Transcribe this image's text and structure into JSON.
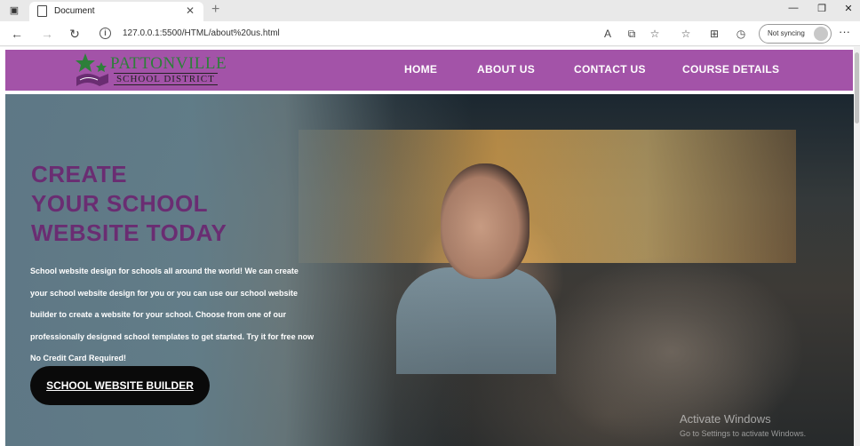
{
  "browser": {
    "tab_title": "Document",
    "tab_close": "✕",
    "new_tab": "+",
    "url": "127.0.0.1:5500/HTML/about%20us.html",
    "profile_text": "Not syncing",
    "window_controls": {
      "minimize": "—",
      "restore": "❐",
      "close": "✕"
    },
    "icons": [
      "back-icon",
      "forward-icon",
      "refresh-icon",
      "info-icon",
      "read-aloud-icon",
      "app-available-icon",
      "add-favorite-icon",
      "favorites-icon",
      "collections-icon",
      "history-icon",
      "more-icon"
    ]
  },
  "site": {
    "logo_main": "PATTONVILLE",
    "logo_sub": "SCHOOL DISTRICT",
    "brand_color": "#a353a8",
    "nav": [
      {
        "label": "HOME"
      },
      {
        "label": "ABOUT US"
      },
      {
        "label": "CONTACT US"
      },
      {
        "label": "COURSE DETAILS"
      }
    ]
  },
  "hero": {
    "title_lines": [
      "CREATE",
      "YOUR SCHOOL",
      "WEBSITE TODAY"
    ],
    "title_color": "#6a2d72",
    "text_lines": [
      "School website design for schools all around the world! We can create",
      "your school website design for you or you can use our school website",
      "builder to create a website for your school. Choose from one of our",
      "professionally designed school templates to get started. Try it for free now",
      "No Credit Card Required!"
    ],
    "cta_label": "SCHOOL WEBSITE BUILDER"
  },
  "watermark": {
    "title": "Activate Windows",
    "subtitle": "Go to Settings to activate Windows."
  }
}
